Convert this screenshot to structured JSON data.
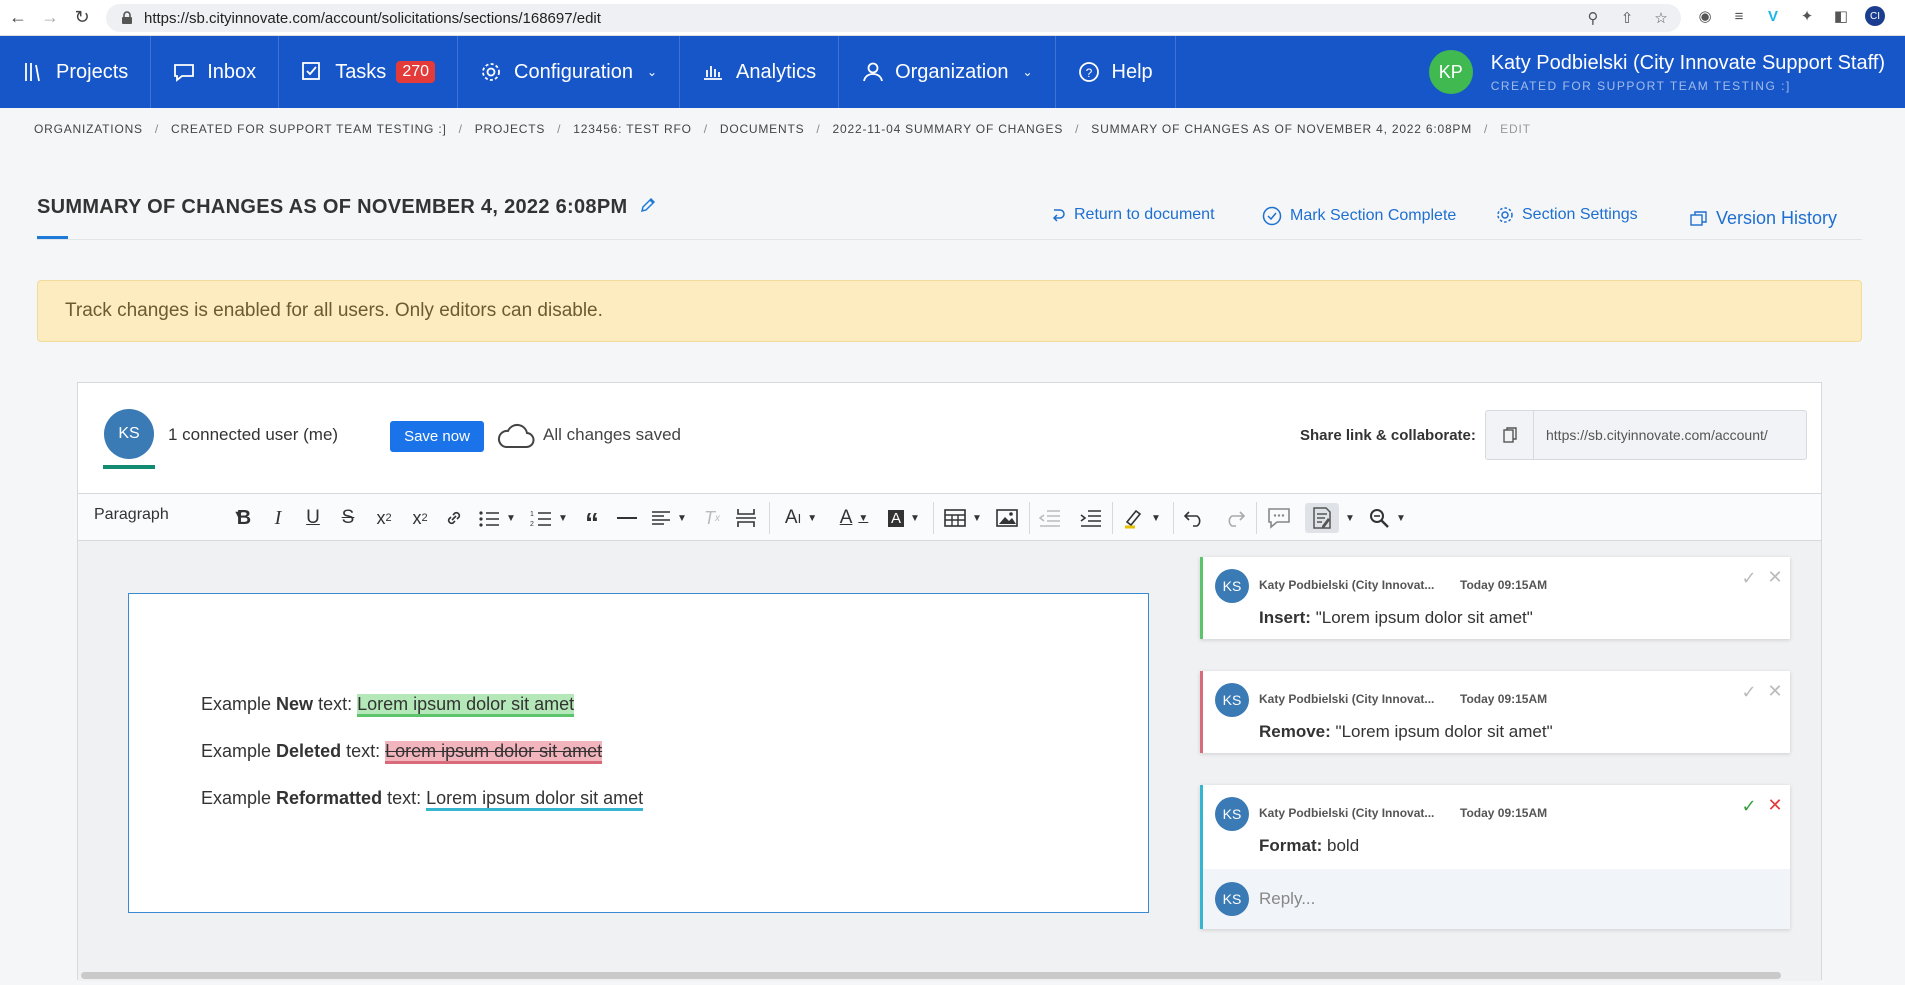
{
  "browser": {
    "url": "https://sb.cityinnovate.com/account/solicitations/sections/168697/edit",
    "profile_initials": "CI"
  },
  "nav": {
    "items": [
      {
        "label": "Projects"
      },
      {
        "label": "Inbox"
      },
      {
        "label": "Tasks",
        "badge": "270"
      },
      {
        "label": "Configuration"
      },
      {
        "label": "Analytics"
      },
      {
        "label": "Organization"
      },
      {
        "label": "Help"
      }
    ],
    "user": {
      "initials": "KP",
      "name": "Katy Podbielski (City Innovate Support Staff)",
      "org": "CREATED FOR SUPPORT TEAM TESTING :]"
    },
    "colors": {
      "bar": "#1656c9",
      "avatar": "#3fb950",
      "badge": "#e33a3a"
    }
  },
  "breadcrumb": [
    "ORGANIZATIONS",
    "CREATED FOR SUPPORT TEAM TESTING :]",
    "PROJECTS",
    "123456: TEST RFO",
    "DOCUMENTS",
    "2022-11-04 SUMMARY OF CHANGES",
    "SUMMARY OF CHANGES AS OF NOVEMBER 4, 2022 6:08PM",
    "EDIT"
  ],
  "header": {
    "title": "SUMMARY OF CHANGES AS OF NOVEMBER 4, 2022 6:08PM",
    "actions": {
      "return": "Return to document",
      "complete": "Mark Section Complete",
      "settings": "Section Settings",
      "history": "Version History"
    }
  },
  "alert": {
    "text": "Track changes is enabled for all users. Only editors can disable."
  },
  "collab": {
    "avatar": "KS",
    "connected": "1 connected user (me)",
    "save_label": "Save now",
    "saved_status": "All changes saved",
    "share_label": "Share link & collaborate:",
    "share_url": "https://sb.cityinnovate.com/account/"
  },
  "toolbar": {
    "paragraph": "Paragraph"
  },
  "document": {
    "lines": [
      {
        "pre": "Example ",
        "bold": "New",
        "mid": " text: ",
        "change": "Lorem ipsum dolor sit amet"
      },
      {
        "pre": "Example ",
        "bold": "Deleted",
        "mid": " text: ",
        "change": "Lorem ipsum dolor sit amet"
      },
      {
        "pre": "Example ",
        "bold": "Reformatted",
        "mid": " text: ",
        "change": "Lorem ipsum dolor sit amet"
      }
    ]
  },
  "suggestions": [
    {
      "avatar": "KS",
      "author": "Katy Podbielski (City Innovat...",
      "time": "Today 09:15AM",
      "type": "Insert:",
      "detail": "\"Lorem ipsum dolor sit amet\""
    },
    {
      "avatar": "KS",
      "author": "Katy Podbielski (City Innovat...",
      "time": "Today 09:15AM",
      "type": "Remove:",
      "detail": "\"Lorem ipsum dolor sit amet\""
    },
    {
      "avatar": "KS",
      "author": "Katy Podbielski (City Innovat...",
      "time": "Today 09:15AM",
      "type": "Format:",
      "detail": "bold",
      "reply_avatar": "KS",
      "reply_placeholder": "Reply..."
    }
  ]
}
